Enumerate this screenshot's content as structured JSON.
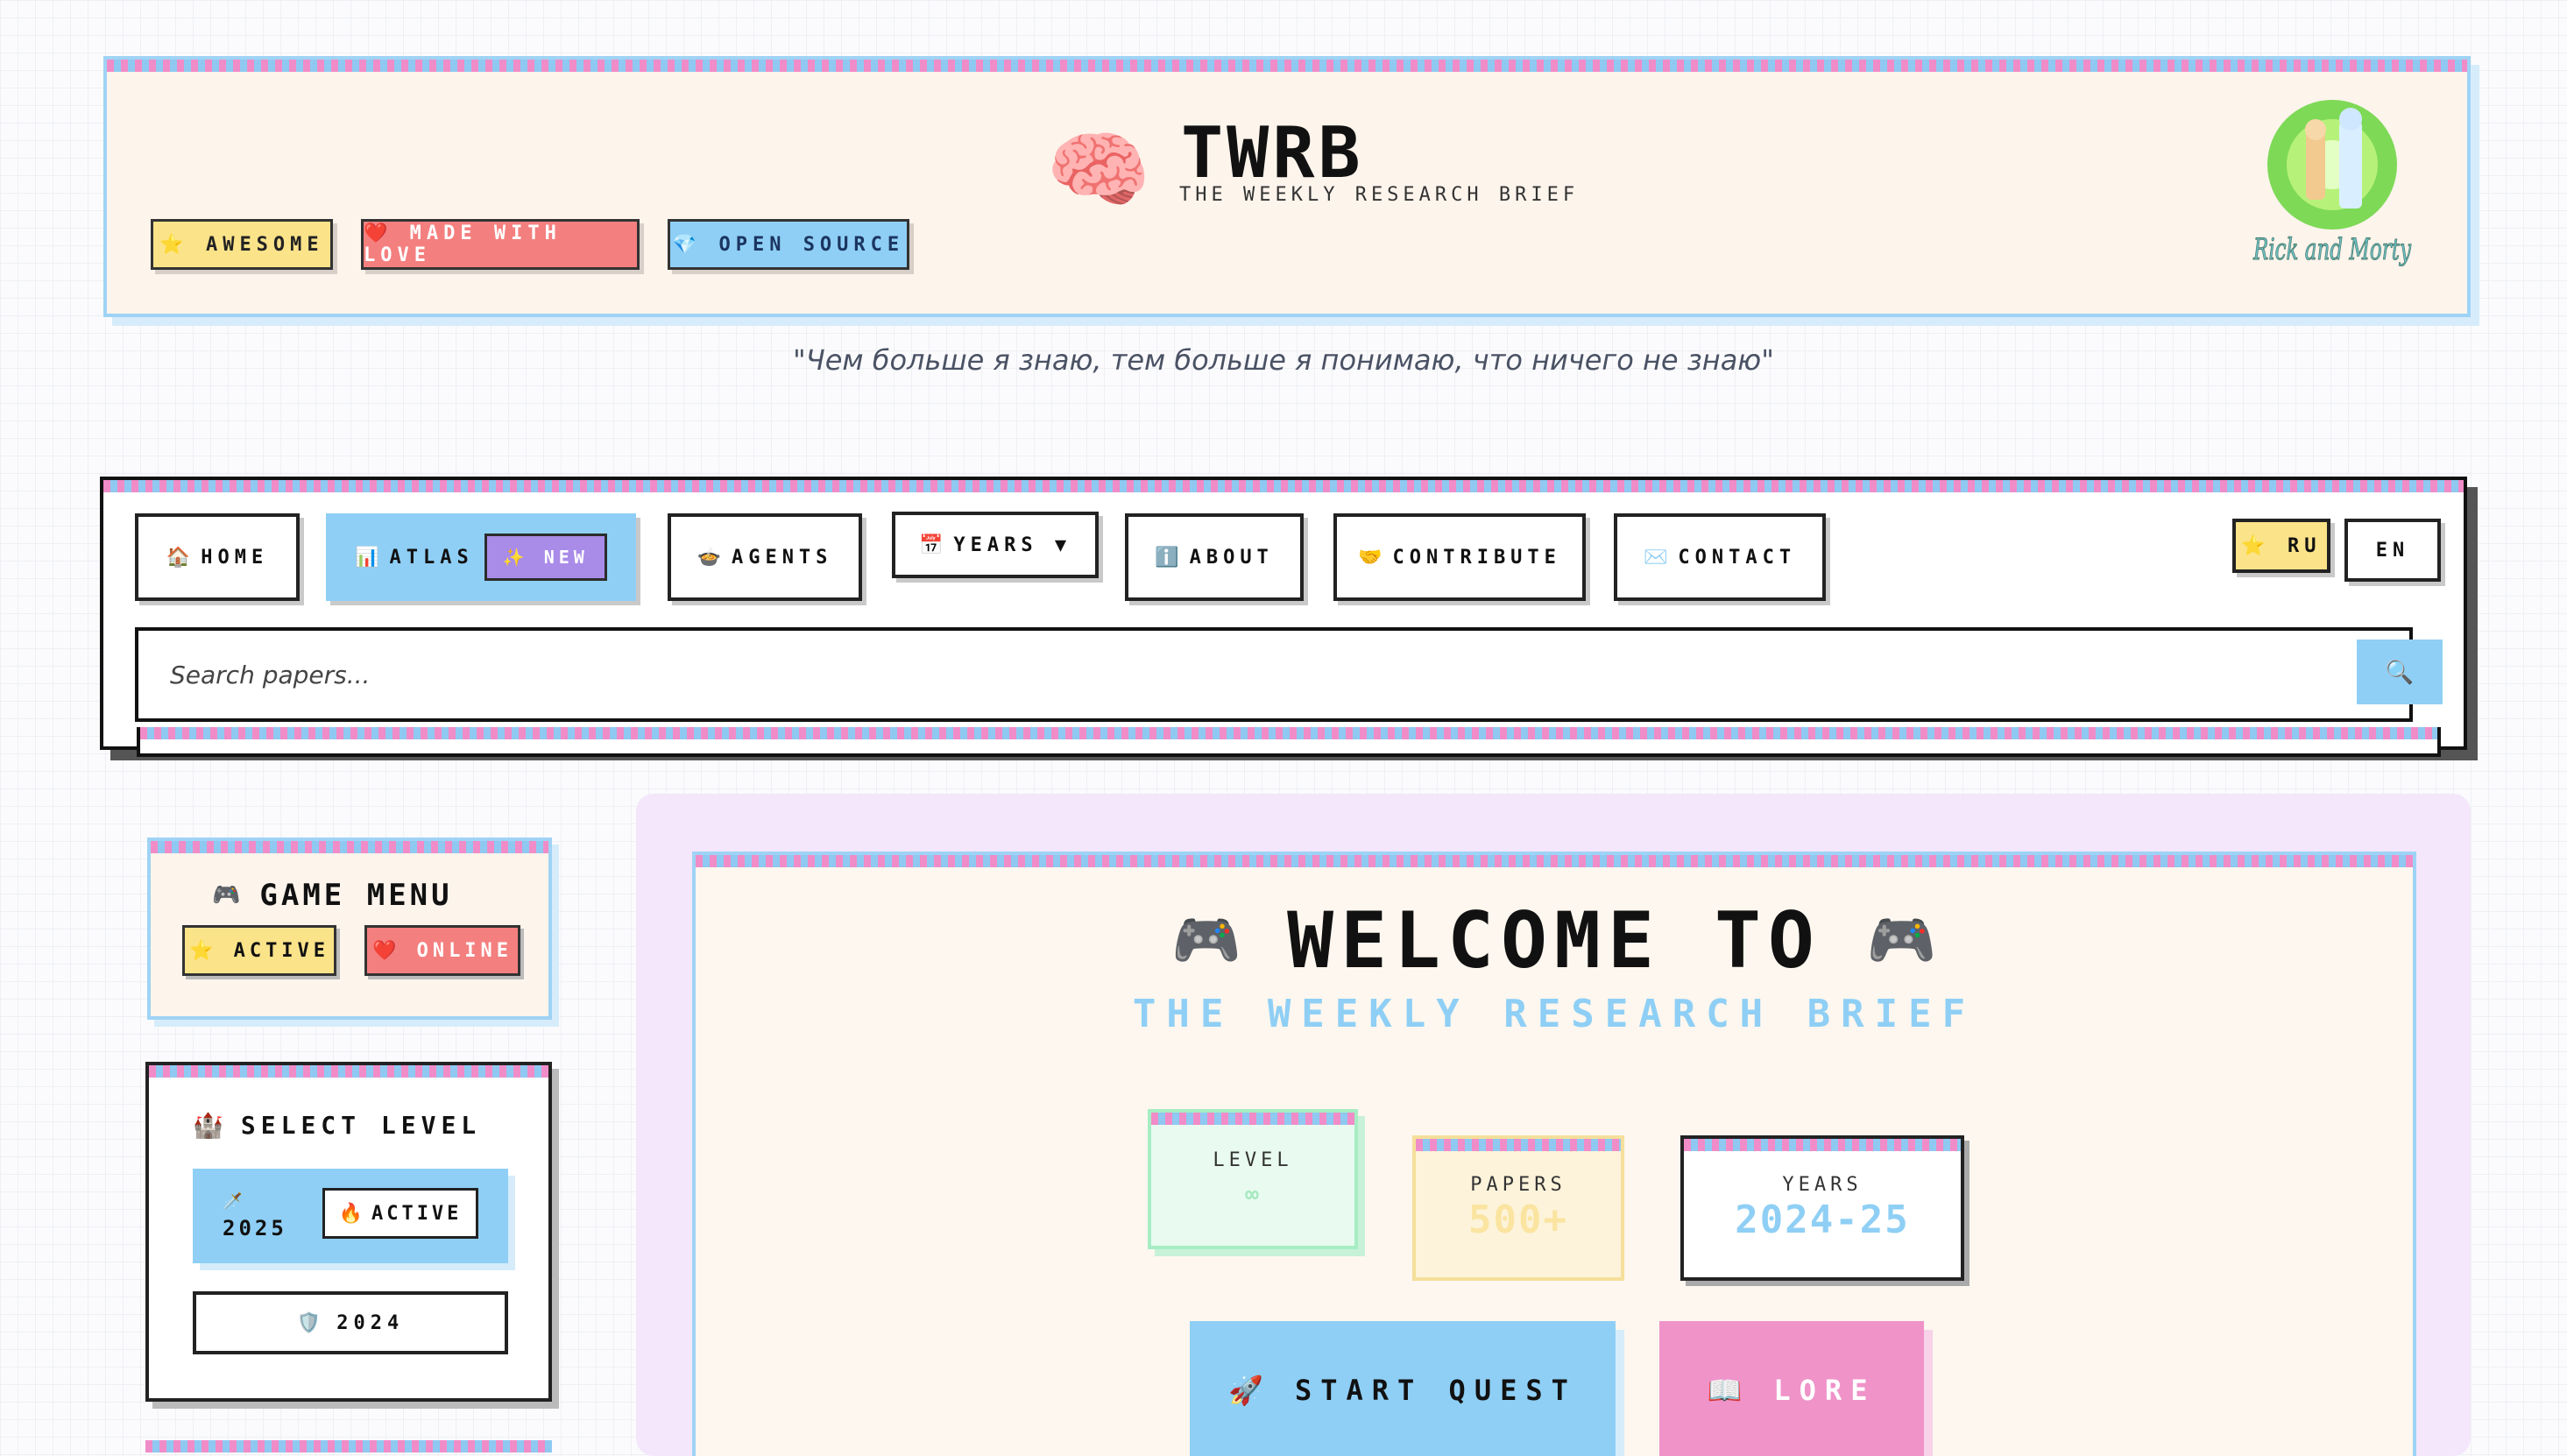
{
  "header": {
    "title": "TWRB",
    "subtitle": "THE WEEKLY RESEARCH BRIEF",
    "badges": [
      "⭐ AWESOME",
      "❤️ MADE WITH LOVE",
      "💎 OPEN SOURCE"
    ],
    "logo_text": "Rick and Morty"
  },
  "quote": "\"Чем больше я знаю, тем больше я понимаю, что ничего не знаю\"",
  "nav": {
    "home": "HOME",
    "atlas": "ATLAS",
    "new_badge": "✨ NEW",
    "agents": "AGENTS",
    "years": "YEARS ▼",
    "about": "ABOUT",
    "contribute": "CONTRIBUTE",
    "contact": "CONTACT",
    "lang_ru": "⭐ RU",
    "lang_en": "EN",
    "search_placeholder": "Search papers..."
  },
  "icons": {
    "home": "🏠",
    "atlas": "📊",
    "agents": "🍲",
    "years": "📅",
    "about": "ℹ️",
    "contribute": "🤝",
    "contact": "✉️",
    "search": "🔍",
    "gamepad": "🎮",
    "castle": "🏰",
    "sword": "🗡️",
    "fire": "🔥",
    "shield": "🛡️",
    "rocket": "🚀",
    "book": "📖",
    "brain": "🧠"
  },
  "sidebar": {
    "game_menu_title": "GAME MENU",
    "active_badge": "⭐ ACTIVE",
    "online_badge": "❤️ ONLINE",
    "select_level_title": "SELECT LEVEL",
    "level_2025": "2025",
    "level_2025_status": "ACTIVE",
    "level_2024": "2024"
  },
  "welcome": {
    "title": "WELCOME TO",
    "subtitle": "THE WEEKLY RESEARCH BRIEF",
    "stats": {
      "level_label": "LEVEL",
      "level_value": "∞",
      "papers_label": "PAPERS",
      "papers_value": "500+",
      "years_label": "YEARS",
      "years_value": "2024-25"
    },
    "start_button": "START QUEST",
    "lore_button": "LORE"
  },
  "colors": {
    "accent_blue": "#8fcff5",
    "accent_pink": "#f08cc8",
    "accent_yellow": "#fbe38a",
    "accent_red": "#f47f7f",
    "accent_purple": "#a98be8"
  }
}
